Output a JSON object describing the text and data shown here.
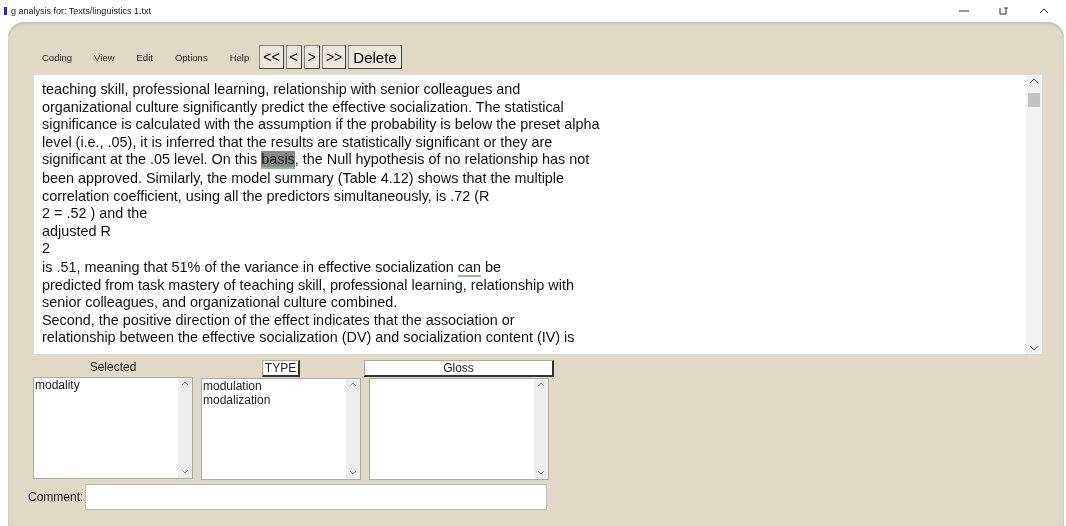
{
  "window": {
    "title": "g analysis for: Texts/linguistics 1.txt"
  },
  "menu": [
    "Coding",
    "View",
    "Edit",
    "Options",
    "Help"
  ],
  "nav_buttons": [
    "<<",
    "<",
    ">",
    ">>"
  ],
  "delete_button": "Delete",
  "text_lines": [
    [
      {
        "text": "teaching skill, professional learning, relationship with senior colleagues and",
        "selected": false,
        "coded": false
      }
    ],
    [
      {
        "text": "organizational culture significantly predict the effective socialization. The statistical",
        "selected": false,
        "coded": false
      }
    ],
    [
      {
        "text": "significance is calculated with the assumption if the probability is below the preset alpha",
        "selected": false,
        "coded": false
      }
    ],
    [
      {
        "text": "level (i.e., .05), it is inferred that the results are statistically significant or they are",
        "selected": false,
        "coded": false
      }
    ],
    [
      {
        "text": "significant at the .05 level. On this",
        "selected": false,
        "coded": false
      },
      {
        "text": "basis",
        "selected": true,
        "coded": true
      },
      {
        "text": ", the Null hypothesis of no relationship has not",
        "selected": false,
        "coded": false
      }
    ],
    [
      {
        "text": "been approved. Similarly, the model summary (Table 4.12) shows that the multiple",
        "selected": false,
        "coded": false
      }
    ],
    [
      {
        "text": "correlation coefficient, using all the predictors simultaneously, is .72 (R",
        "selected": false,
        "coded": false
      }
    ],
    [
      {
        "text": "2 = .52 ) and the",
        "selected": false,
        "coded": false
      }
    ],
    [
      {
        "text": "adjusted R",
        "selected": false,
        "coded": false
      }
    ],
    [
      {
        "text": "2",
        "selected": false,
        "coded": false
      }
    ],
    [
      {
        "text": "is .51, meaning that 51% of the variance in effective socialization",
        "selected": false,
        "coded": false
      },
      {
        "text": "can",
        "selected": false,
        "coded": true
      },
      {
        "text": "be",
        "selected": false,
        "coded": false
      }
    ],
    [
      {
        "text": "predicted from task mastery of teaching skill, professional learning, relationship with",
        "selected": false,
        "coded": false
      }
    ],
    [
      {
        "text": "senior colleagues, and organizational culture combined.",
        "selected": false,
        "coded": false
      }
    ],
    [
      {
        "text": "Second, the positive direction of the effect indicates that the association or",
        "selected": false,
        "coded": false
      }
    ],
    [
      {
        "text": "relationship between the effective socialization (DV) and socialization content (IV) is",
        "selected": false,
        "coded": false
      }
    ]
  ],
  "panels": [
    {
      "heading": "Selected",
      "kind": "label",
      "items": [
        "modality"
      ]
    },
    {
      "heading": "TYPE",
      "kind": "button",
      "items": [
        "modulation",
        "modalization"
      ]
    },
    {
      "heading": "Gloss",
      "kind": "wide"
    }
  ],
  "comment": {
    "label": "Comment:"
  }
}
